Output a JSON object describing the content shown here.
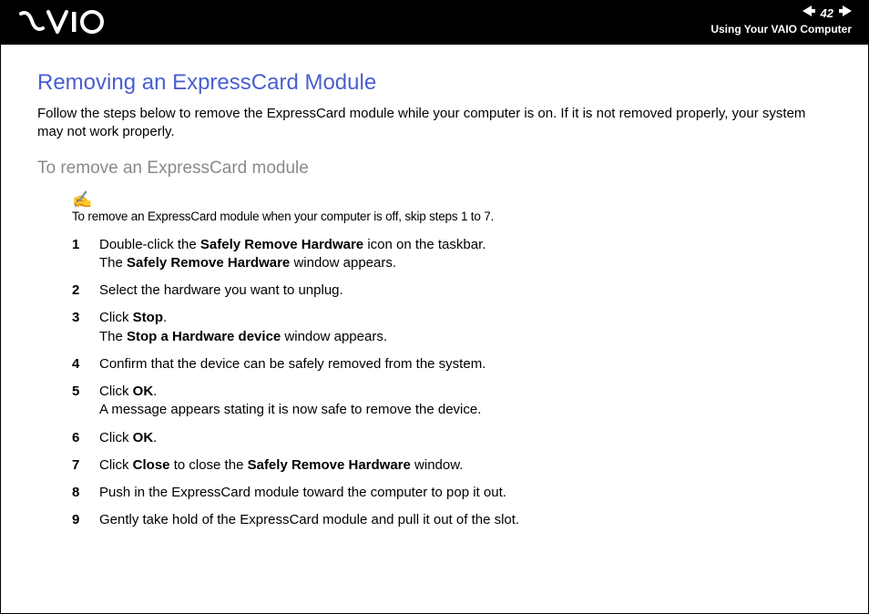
{
  "header": {
    "page_number": "42",
    "section": "Using Your VAIO Computer"
  },
  "content": {
    "title": "Removing an ExpressCard Module",
    "intro": "Follow the steps below to remove the ExpressCard module while your computer is on. If it is not removed properly, your system may not work properly.",
    "subtitle": "To remove an ExpressCard module",
    "note": "To remove an ExpressCard module when your computer is off, skip steps 1 to 7.",
    "steps": [
      {
        "pre": "Double-click the ",
        "b1": "Safely Remove Hardware",
        "mid": " icon on the taskbar.\nThe ",
        "b2": "Safely Remove Hardware",
        "post": " window appears."
      },
      {
        "text": "Select the hardware you want to unplug."
      },
      {
        "pre": "Click ",
        "b1": "Stop",
        "mid": ".\nThe ",
        "b2": "Stop a Hardware device",
        "post": " window appears."
      },
      {
        "text": "Confirm that the device can be safely removed from the system."
      },
      {
        "pre": "Click ",
        "b1": "OK",
        "mid": ".\nA message appears stating it is now safe to remove the device.",
        "b2": "",
        "post": ""
      },
      {
        "pre": "Click ",
        "b1": "OK",
        "mid": ".",
        "b2": "",
        "post": ""
      },
      {
        "pre": "Click ",
        "b1": "Close",
        "mid": " to close the ",
        "b2": "Safely Remove Hardware",
        "post": " window."
      },
      {
        "text": "Push in the ExpressCard module toward the computer to pop it out."
      },
      {
        "text": "Gently take hold of the ExpressCard module and pull it out of the slot."
      }
    ]
  }
}
